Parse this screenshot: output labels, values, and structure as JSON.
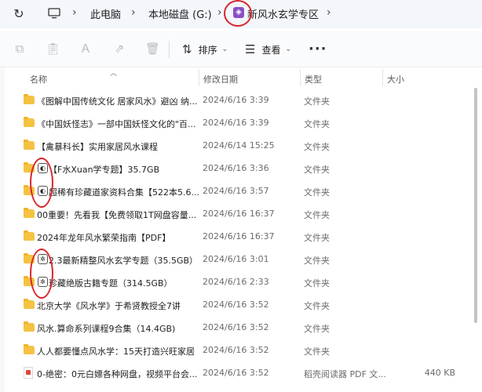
{
  "address": {
    "breadcrumbs": [
      "此电脑",
      "本地磁盘 (G:)",
      "新风水玄学专区"
    ],
    "refresh_icon": "refresh-icon",
    "pc_icon": "monitor-icon"
  },
  "toolbar": {
    "sort_label": "排序",
    "view_label": "查看",
    "more_label": "···",
    "disabled_icons": [
      "copy-icon",
      "paste-icon",
      "rename-icon",
      "share-icon",
      "delete-icon"
    ]
  },
  "columns": {
    "name": "名称",
    "date": "修改日期",
    "type": "类型",
    "size": "大小"
  },
  "files": [
    {
      "name": "《图解中国传统文化 居家风水》避凶 纳...",
      "date": "2024/6/16 3:39",
      "type": "文件夹",
      "size": "",
      "icon": "folder",
      "overlay": ""
    },
    {
      "name": "《中国妖怪志》一部中国妖怪文化的\"百...",
      "date": "2024/6/16 3:39",
      "type": "文件夹",
      "size": "",
      "icon": "folder",
      "overlay": ""
    },
    {
      "name": "【禽暴科长】实用家居风水课程",
      "date": "2024/6/14 15:25",
      "type": "文件夹",
      "size": "",
      "icon": "folder",
      "overlay": ""
    },
    {
      "name": "【F水Xuan学专题】35.7GB",
      "date": "2024/6/16 3:36",
      "type": "文件夹",
      "size": "",
      "icon": "folder",
      "overlay": "◐"
    },
    {
      "name": "超稀有珍藏道家资料合集【522本5.6...",
      "date": "2024/6/16 3:57",
      "type": "文件夹",
      "size": "",
      "icon": "folder",
      "overlay": "◐"
    },
    {
      "name": "00重要！先看我【免费领取1T网盘容量...",
      "date": "2024/6/16 16:37",
      "type": "文件夹",
      "size": "",
      "icon": "folder",
      "overlay": ""
    },
    {
      "name": "2024年龙年风水繁荣指南【PDF】",
      "date": "2024/6/16 16:37",
      "type": "文件夹",
      "size": "",
      "icon": "folder",
      "overlay": ""
    },
    {
      "name": "2.3最新精整风水玄学专题（35.5GB）",
      "date": "2024/6/16 3:01",
      "type": "文件夹",
      "size": "",
      "icon": "folder",
      "overlay": "✲"
    },
    {
      "name": "珍藏绝版古籍专题（314.5GB）",
      "date": "2024/6/16 2:33",
      "type": "文件夹",
      "size": "",
      "icon": "folder",
      "overlay": "✲"
    },
    {
      "name": "北京大学《风水学》于希贤教授全7讲",
      "date": "2024/6/16 3:52",
      "type": "文件夹",
      "size": "",
      "icon": "folder",
      "overlay": ""
    },
    {
      "name": "风水.算命系列课程9合集（14.4GB)",
      "date": "2024/6/16 3:52",
      "type": "文件夹",
      "size": "",
      "icon": "folder",
      "overlay": ""
    },
    {
      "name": "人人都要懂点风水学：15天打造兴旺家居",
      "date": "2024/6/16 3:52",
      "type": "文件夹",
      "size": "",
      "icon": "folder",
      "overlay": ""
    },
    {
      "name": "0-绝密：0元白嫖各种网盘，视频平台会...",
      "date": "2024/6/16 3:52",
      "type": "稻壳阅读器 PDF 文...",
      "size": "440 KB",
      "icon": "pdf",
      "overlay": ""
    }
  ],
  "accent": {
    "circle": "#d8262d",
    "folder": "#f5c242"
  }
}
